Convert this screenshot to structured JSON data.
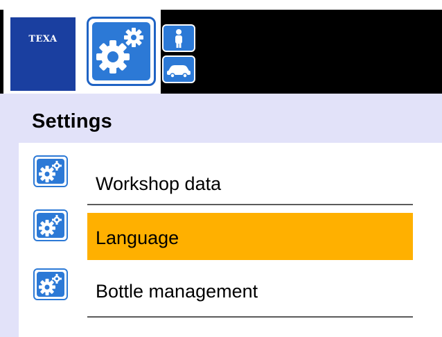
{
  "header": {
    "logo_text": "TEXA",
    "app_icon": "gears-icon",
    "small_buttons": [
      {
        "icon": "person-icon"
      },
      {
        "icon": "car-icon"
      }
    ]
  },
  "page": {
    "title": "Settings"
  },
  "menu": {
    "items": [
      {
        "label": "Workshop data",
        "icon": "gears-icon",
        "selected": false
      },
      {
        "label": "Language",
        "icon": "gears-icon",
        "selected": true
      },
      {
        "label": "Bottle management",
        "icon": "gears-icon",
        "selected": false
      }
    ]
  },
  "colors": {
    "brand_blue": "#1a3fa0",
    "icon_blue": "#2c79d6",
    "title_band": "#e2e2f9",
    "selected": "#ffb000",
    "header_bg": "#000000"
  }
}
